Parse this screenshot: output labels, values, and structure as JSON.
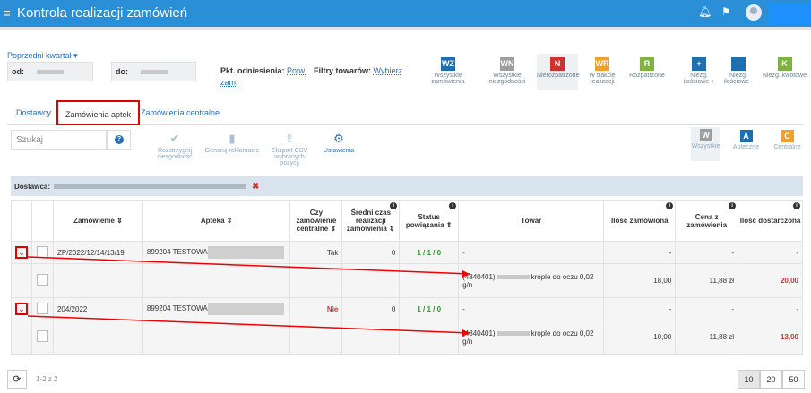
{
  "app": {
    "title": "Kontrola realizacji zamówień"
  },
  "filters": {
    "prev_period": "Poprzedni kwartał ▾",
    "from_label": "od:",
    "to_label": "do:",
    "ref_label": "Pkt. odniesienia:",
    "ref_value_1": "Potw.",
    "ref_value_2": "zam.",
    "goods_label": "Filtry towarów:",
    "goods_value": "Wybierz",
    "buttons": [
      {
        "code": "WZ",
        "label": "Wszystkie zamówienia",
        "color": "#1d6fb1"
      },
      {
        "code": "WN",
        "label": "Wszystkie niezgodności",
        "color": "#9e9e9e"
      },
      {
        "code": "N",
        "label": "Nierozpatrzone",
        "color": "#d32f2f"
      },
      {
        "code": "WR",
        "label": "W trakcie realizacji",
        "color": "#f0a030"
      },
      {
        "code": "R",
        "label": "Rozpatrzone",
        "color": "#7cb342"
      },
      {
        "code": "+",
        "label": "Niezg. ilościowe +",
        "color": "#1d6fb1"
      },
      {
        "code": "-",
        "label": "Niezg. ilościowe -",
        "color": "#1d6fb1"
      },
      {
        "code": "K",
        "label": "Niezg. kwotowe",
        "color": "#7cb342"
      }
    ]
  },
  "tabs": [
    "Dostawcy",
    "Zamówienia aptek",
    "Zamówienia centralne"
  ],
  "search": {
    "placeholder": "Szukaj"
  },
  "actions": [
    "Rozstrzygnij niezgodność",
    "Generuj reklamacje",
    "Eksport CSV wybranych pozycji",
    "Ustawienia"
  ],
  "views": [
    {
      "code": "W",
      "label": "Wszystkie",
      "color": "#9e9e9e"
    },
    {
      "code": "A",
      "label": "Apteczne",
      "color": "#1d6fb1"
    },
    {
      "code": "C",
      "label": "Centralne",
      "color": "#f0a030"
    }
  ],
  "supplier": {
    "label": "Dostawca:"
  },
  "table": {
    "headers": [
      "Zamówienie",
      "Apteka",
      "Czy zamówienie centralne",
      "Średni czas realizacji zamówienia",
      "Status powiązania",
      "Towar",
      "Ilość zamówiona",
      "Cena z zamówienia",
      "Ilość dostarczona"
    ],
    "orders": [
      {
        "number": "ZP/2022/12/14/13/19",
        "pharmacy": "899204 TESTOWA",
        "central": "Tak",
        "avg_time": "0",
        "status": "1 / 1 / 0",
        "towar": "-",
        "qty": "-",
        "price": "-",
        "delivered": "-",
        "item": {
          "code": "(4840401)",
          "name": "krople do oczu 0,02 g/n",
          "qty": "18,00",
          "price": "11,88 zł",
          "delivered": "20,00"
        }
      },
      {
        "number": "204/2022",
        "pharmacy": "899204 TESTOWA",
        "central": "Nie",
        "avg_time": "0",
        "status": "1 / 1 / 0",
        "towar": "-",
        "qty": "-",
        "price": "-",
        "delivered": "-",
        "item": {
          "code": "(4840401)",
          "name": "krople do oczu 0,02 g/n",
          "qty": "10,00",
          "price": "11,88 zł",
          "delivered": "13,00"
        }
      }
    ]
  },
  "pagination": {
    "info": "1-2 z 2",
    "sizes": [
      "10",
      "20",
      "50"
    ]
  }
}
